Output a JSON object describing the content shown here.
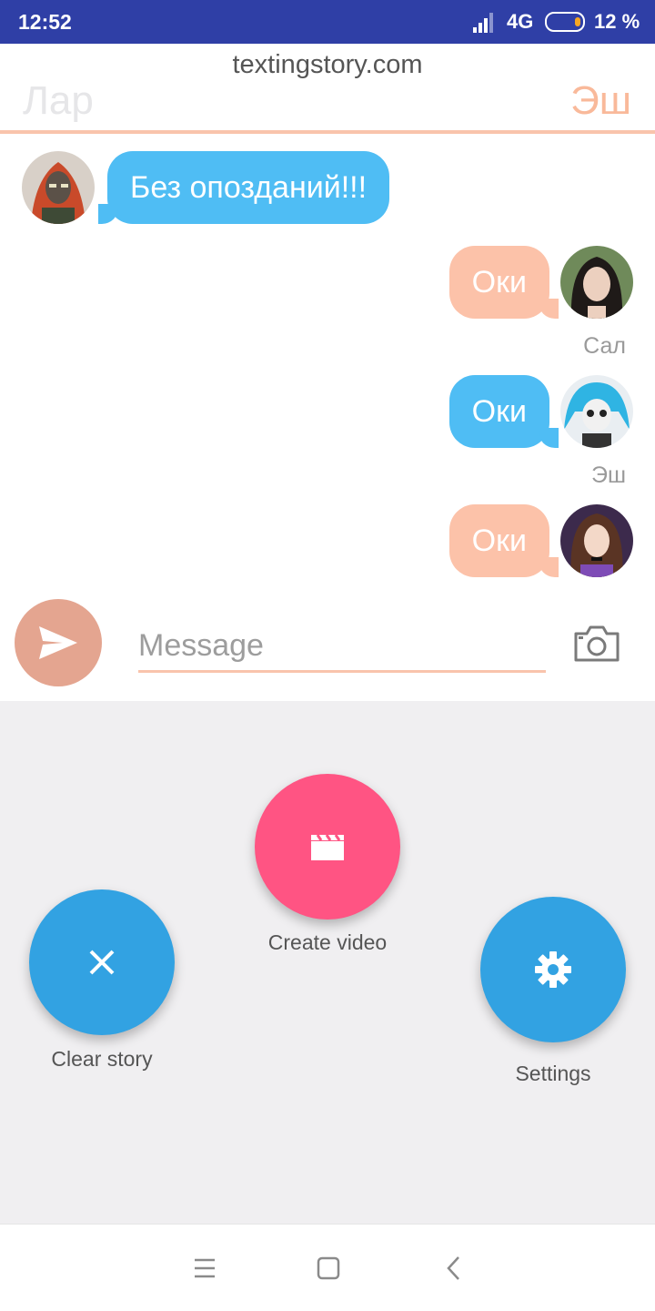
{
  "status_bar": {
    "time": "12:52",
    "network": "4G",
    "battery": "12 %"
  },
  "header": {
    "site": "textingstory.com",
    "left_name": "Лар",
    "right_name": "Эш"
  },
  "messages": [
    {
      "text": "Без опозданий!!!",
      "side": "left",
      "color": "blue"
    },
    {
      "text": "Оки",
      "side": "right",
      "color": "peach",
      "sender": "Сал"
    },
    {
      "text": "Оки",
      "side": "right",
      "color": "blue",
      "sender": "Эш"
    },
    {
      "text": "Оки",
      "side": "right",
      "color": "peach"
    }
  ],
  "composer": {
    "placeholder": "Message"
  },
  "actions": {
    "create_video": "Create video",
    "clear_story": "Clear story",
    "settings": "Settings"
  },
  "colors": {
    "blue_bubble": "#4fbdf4",
    "peach_bubble": "#fcc2a9",
    "accent_pink": "#ff5483",
    "accent_blue": "#32a2e2",
    "status_bar": "#2f3fa6"
  },
  "icons": [
    "signal-icon",
    "battery-icon",
    "send-icon",
    "camera-icon",
    "film-clapper-icon",
    "close-icon",
    "gear-icon",
    "menu-icon",
    "home-icon",
    "back-icon"
  ]
}
